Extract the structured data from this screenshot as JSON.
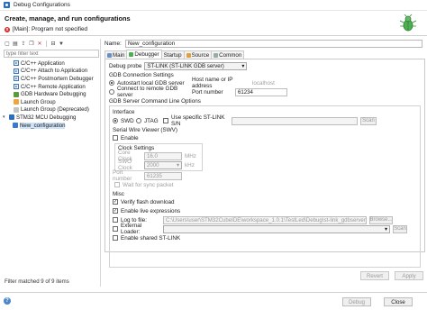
{
  "window": {
    "title": "Debug Configurations"
  },
  "header": {
    "title": "Create, manage, and run configurations",
    "error": "[Main]: Program not specified"
  },
  "left": {
    "filter_placeholder": "type filter text",
    "tree": [
      {
        "label": "C/C++ Application",
        "icon": "c-icon",
        "level": 0
      },
      {
        "label": "C/C++ Attach to Application",
        "icon": "c-icon",
        "level": 0
      },
      {
        "label": "C/C++ Postmortem Debugger",
        "icon": "c-icon",
        "level": 0
      },
      {
        "label": "C/C++ Remote Application",
        "icon": "c-icon",
        "level": 0
      },
      {
        "label": "GDB Hardware Debugging",
        "icon": "gdb-icon",
        "level": 0
      },
      {
        "label": "Launch Group",
        "icon": "launch-icon",
        "level": 0
      },
      {
        "label": "Launch Group (Deprecated)",
        "icon": "launch-deprecated-icon",
        "level": 0
      },
      {
        "label": "STM32 MCU Debugging",
        "icon": "stm32-icon",
        "level": 0,
        "expanded": true
      },
      {
        "label": "New_configuration",
        "icon": "config-icon",
        "level": 1,
        "selected": true
      }
    ],
    "status": "Filter matched 9 of 9 items"
  },
  "main": {
    "name_label": "Name:",
    "name_value": "New_configuration",
    "tabs": [
      {
        "label": "Main"
      },
      {
        "label": "Debugger",
        "active": true
      },
      {
        "label": "Startup"
      },
      {
        "label": "Source"
      },
      {
        "label": "Common"
      }
    ],
    "debugger": {
      "probe_label": "Debug probe",
      "probe_value": "ST-LINK (ST-LINK GDB server)",
      "gdb_conn_title": "GDB Connection Settings",
      "autostart_label": "Autostart local GDB server",
      "host_label": "Host name or IP address",
      "host_value": "localhost",
      "remote_label": "Connect to remote GDB server",
      "port_label": "Port number",
      "port_value": "61234",
      "cmdline_title": "GDB Server Command Line Options",
      "interface_title": "Interface",
      "swd_label": "SWD",
      "jtag_label": "JTAG",
      "use_sn_label": "Use specific ST-LINK S/N",
      "scan_label": "Scan",
      "swv_title": "Serial Wire Viewer (SWV)",
      "enable_label": "Enable",
      "clock_title": "Clock Settings",
      "core_clock_label": "Core Clock",
      "core_clock_value": "16.0",
      "core_clock_unit": "MHz",
      "swo_clock_label": "SWO Clock",
      "swo_clock_value": "2000",
      "swo_clock_unit": "kHz",
      "port_num_label": "Port number",
      "port_num_value": "61235",
      "wait_sync_label": "Wait for sync packet",
      "misc_title": "Misc",
      "verify_label": "Verify flash download",
      "live_expr_label": "Enable live expressions",
      "log_label": "Log to file:",
      "log_value": "C:\\Users\\user\\STM32CubeIDE\\workspace_1.0.1\\TestLed\\Debug\\st-link_gdbserver_log.txt",
      "browse_label": "Browse...",
      "ext_loader_label": "External Loader:",
      "scan2_label": "Scan",
      "shared_label": "Enable shared ST-LINK"
    },
    "revert_label": "Revert",
    "apply_label": "Apply"
  },
  "footer": {
    "debug_label": "Debug",
    "close_label": "Close"
  },
  "colors": {
    "accent": "#2a6fbf",
    "error": "#d32f2f",
    "selected": "#cfe3f7"
  }
}
